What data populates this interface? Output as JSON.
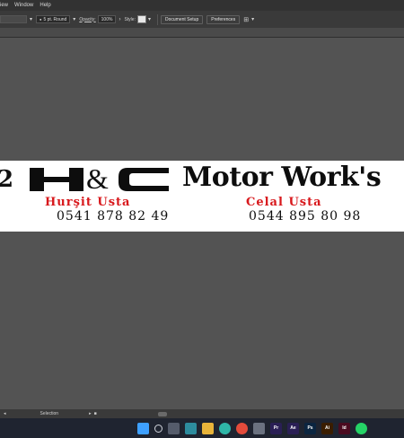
{
  "menubar": {
    "items": [
      "iew",
      "Window",
      "Help"
    ]
  },
  "control_bar": {
    "stroke_profile": "5 pt. Round",
    "opacity_label": "Opacity:",
    "opacity_value": "100%",
    "style_label": "Style:",
    "document_setup": "Document Setup",
    "preferences": "Preferences"
  },
  "artboard": {
    "edge_text": "2",
    "ampersand": "&",
    "title": "Motor Work's",
    "name1": "Hurşit Usta",
    "phone1": "0541 878 82 49",
    "name2": "Celal Usta",
    "phone2": "0544 895 80 98"
  },
  "status_bar": {
    "tool": "Selection"
  },
  "taskbar": {
    "icons": [
      {
        "name": "windows-start-icon",
        "label": "",
        "color": "#3ea0ff"
      },
      {
        "name": "search-icon",
        "label": "",
        "color": "#1f2430"
      },
      {
        "name": "task-view-icon",
        "label": "",
        "color": "#555c6b"
      },
      {
        "name": "widgets-icon",
        "label": "",
        "color": "#2d8c9e"
      },
      {
        "name": "file-explorer-icon",
        "label": "",
        "color": "#e8b43a"
      },
      {
        "name": "edge-icon",
        "label": "",
        "color": "#2fb6a8"
      },
      {
        "name": "chrome-icon",
        "label": "",
        "color": "#e34b3b"
      },
      {
        "name": "settings-icon",
        "label": "",
        "color": "#6b7280"
      },
      {
        "name": "premiere-icon",
        "label": "Pr",
        "color": "#2a1f55"
      },
      {
        "name": "after-effects-icon",
        "label": "Ae",
        "color": "#2a1f55"
      },
      {
        "name": "photoshop-icon",
        "label": "Ps",
        "color": "#0b2540"
      },
      {
        "name": "illustrator-icon",
        "label": "Ai",
        "color": "#3a1d00"
      },
      {
        "name": "indesign-icon",
        "label": "Id",
        "color": "#4a0b20"
      },
      {
        "name": "whatsapp-icon",
        "label": "",
        "color": "#25d366"
      }
    ]
  }
}
